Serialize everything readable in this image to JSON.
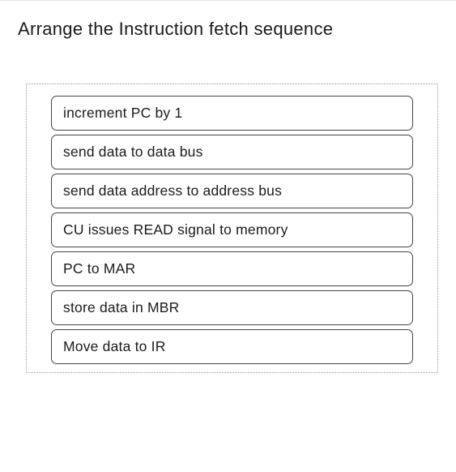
{
  "question": {
    "title": "Arrange the Instruction fetch sequence"
  },
  "items": [
    {
      "label": "increment PC by 1"
    },
    {
      "label": "send data to data bus"
    },
    {
      "label": "send data address to address bus"
    },
    {
      "label": "CU issues READ signal to memory"
    },
    {
      "label": "PC to MAR"
    },
    {
      "label": "store data in MBR"
    },
    {
      "label": "Move data to IR"
    }
  ]
}
